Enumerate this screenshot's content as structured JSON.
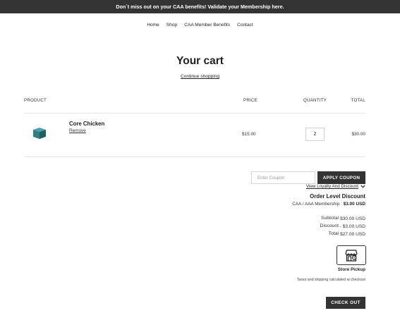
{
  "announcement": "Don`t miss out on your CAA benefits! Validate your Membership here.",
  "nav": {
    "items": [
      "Home",
      "Shop",
      "CAA Member Benefits",
      "Contact"
    ]
  },
  "page": {
    "title": "Your cart",
    "continue_shopping": "Continue shopping"
  },
  "table": {
    "headers": {
      "product": "PRODUCT",
      "price": "PRICE",
      "quantity": "QUANTITY",
      "total": "TOTAL"
    },
    "rows": [
      {
        "name": "Core Chicken",
        "remove_label": "Remove",
        "price": "$15.00",
        "quantity": "2",
        "total": "$30.00",
        "thumb_icon": "teal-product-box"
      }
    ]
  },
  "coupon": {
    "placeholder": "Enter Coupon",
    "apply_label": "APPLY COUPON"
  },
  "loyalty": {
    "label": "View Loyalty And Discount",
    "icon": "chevron-down-icon"
  },
  "order_discount": {
    "title": "Order Level Discount",
    "membership_label": "CAA / AAA Membership :",
    "membership_amount": "$3.00 USD"
  },
  "summary": {
    "subtotal_label": "Subtotal",
    "subtotal_value": "$30.00 USD",
    "discount_label": "Discount",
    "discount_value": "- $3.00 USD",
    "total_label": "Total",
    "total_value": "$27.00 USD"
  },
  "pickup": {
    "label": "Store Pickup",
    "icon": "store-pickup-icon"
  },
  "taxes_note": "Taxes and shipping calculated at checkout",
  "checkout_label": "CHECK OUT",
  "colors": {
    "dark": "#333333",
    "product_teal": "#2f7f86"
  }
}
